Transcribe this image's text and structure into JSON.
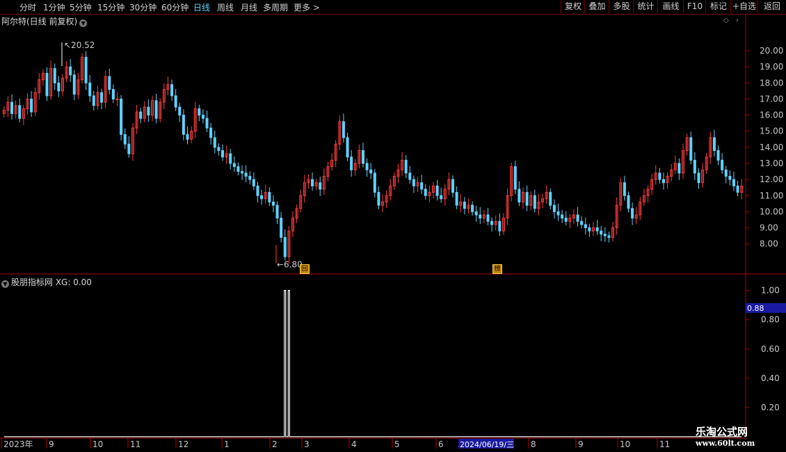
{
  "toolbar": {
    "periods": [
      "分时",
      "1分钟",
      "5分钟",
      "15分钟",
      "30分钟",
      "60分钟",
      "日线",
      "周线",
      "月线",
      "多周期",
      "更多 >"
    ],
    "active": "日线",
    "right_buttons": [
      "复权",
      "叠加",
      "多股",
      "统计",
      "画线",
      "F10",
      "标记",
      "+自选",
      "返回"
    ]
  },
  "stock_title": "阿尔特(日线 前复权)",
  "indicator_title": "股朋指标网  XG: 0.00",
  "badges": {
    "hui": "回",
    "bang": "榜"
  },
  "price_high_label": "20.52",
  "price_low_label": "6.80",
  "cursor_value": "0.88",
  "cursor_date": "2024/06/19/三",
  "watermark": {
    "line1": "乐淘公式网",
    "line2": "www.60lt.com"
  },
  "colors": {
    "up": "#ff3c3c",
    "down": "#5fd3ff",
    "axis": "#b00000",
    "text": "#c8c8c8",
    "cursor": "#1a1aa0"
  },
  "chart_data": [
    {
      "type": "candlestick",
      "name": "price",
      "y_ticks": [
        8,
        9,
        10,
        11,
        12,
        13,
        14,
        15,
        16,
        17,
        18,
        19,
        20
      ],
      "y_tick_labels": [
        "8.00",
        "9.00",
        "10.00",
        "11.00",
        "12.00",
        "13.00",
        "14.00",
        "15.00",
        "16.00",
        "17.00",
        "18.00",
        "19.00",
        "20.00"
      ],
      "ylim": [
        6.3,
        21.6
      ],
      "x_labels": [
        "2023年",
        "9",
        "10",
        "11",
        "12",
        "1",
        "2",
        "3",
        "4",
        "5",
        "6",
        "7",
        "8",
        "9",
        "10",
        "11"
      ],
      "close": [
        16.3,
        16.8,
        16.1,
        16.6,
        15.8,
        16.4,
        17.0,
        16.2,
        17.4,
        18.2,
        18.6,
        17.2,
        18.9,
        18.0,
        17.5,
        18.3,
        19.0,
        18.5,
        17.3,
        18.2,
        19.6,
        18.0,
        17.2,
        16.6,
        17.4,
        16.8,
        18.4,
        17.6,
        17.0,
        17.0,
        14.8,
        14.2,
        13.6,
        15.2,
        16.2,
        15.8,
        16.5,
        16.0,
        16.9,
        15.8,
        16.8,
        17.6,
        17.9,
        17.2,
        16.5,
        16.0,
        14.8,
        14.5,
        15.0,
        16.4,
        16.0,
        15.8,
        15.2,
        14.6,
        14.0,
        13.8,
        13.4,
        13.6,
        13.0,
        12.8,
        12.5,
        12.4,
        12.2,
        12.0,
        11.6,
        11.0,
        10.8,
        11.2,
        10.6,
        10.4,
        9.6,
        8.4,
        7.2,
        8.8,
        9.6,
        10.2,
        11.0,
        11.8,
        12.0,
        11.6,
        11.8,
        11.4,
        12.2,
        12.8,
        13.2,
        14.2,
        15.6,
        14.6,
        13.4,
        12.6,
        13.0,
        13.8,
        13.0,
        12.6,
        12.4,
        11.2,
        10.4,
        10.6,
        11.0,
        11.6,
        12.2,
        12.6,
        13.2,
        12.4,
        12.0,
        11.6,
        11.8,
        11.4,
        11.0,
        11.2,
        11.6,
        11.0,
        10.8,
        11.4,
        12.0,
        11.2,
        10.4,
        10.6,
        10.2,
        10.4,
        10.0,
        9.8,
        9.6,
        9.8,
        9.4,
        9.2,
        9.4,
        8.8,
        9.6,
        11.0,
        12.8,
        11.4,
        10.6,
        11.2,
        10.4,
        11.0,
        10.2,
        10.6,
        10.8,
        11.2,
        10.4,
        10.0,
        9.8,
        9.6,
        9.4,
        9.6,
        9.8,
        9.4,
        9.2,
        9.0,
        8.8,
        9.0,
        8.8,
        8.6,
        8.5,
        8.4,
        9.0,
        10.4,
        11.8,
        11.0,
        10.2,
        9.6,
        9.8,
        10.6,
        11.0,
        11.4,
        12.0,
        12.4,
        12.0,
        11.8,
        12.2,
        12.6,
        13.0,
        12.4,
        13.8,
        14.6,
        13.2,
        12.4,
        11.8,
        12.6,
        13.4,
        14.6,
        13.8,
        13.2,
        12.6,
        12.2,
        12.0,
        11.6,
        11.2,
        11.6
      ]
    },
    {
      "type": "line",
      "name": "XG",
      "y_ticks": [
        0.2,
        0.4,
        0.6,
        0.8,
        1.0
      ],
      "y_tick_labels": [
        "0.20",
        "0.40",
        "0.60",
        "0.80",
        "1.00"
      ],
      "ylim": [
        0,
        1.06
      ],
      "spike_at": [
        72,
        73
      ]
    }
  ]
}
